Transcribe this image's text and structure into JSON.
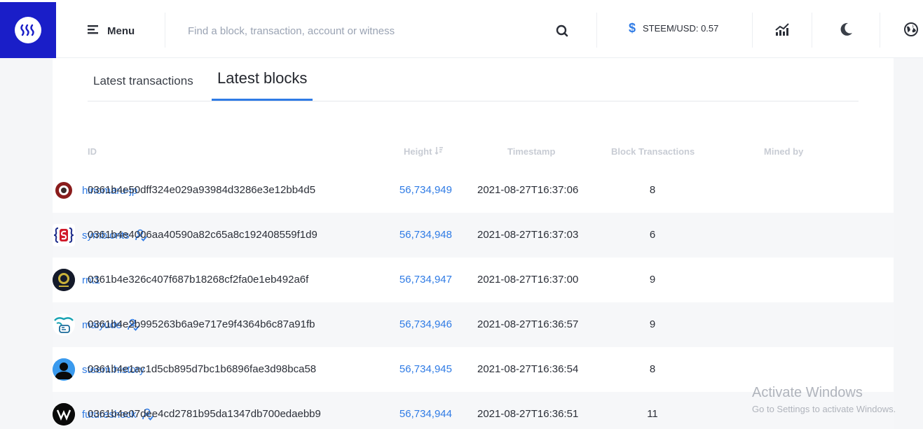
{
  "header": {
    "menu_label": "Menu",
    "search_placeholder": "Find a block, transaction, account or witness",
    "price_label": "STEEM/USD: 0.57",
    "icons": [
      "steem-logo-icon",
      "menu-icon",
      "search-icon",
      "dollar-icon",
      "chart-icon",
      "moon-icon",
      "globe-icon"
    ]
  },
  "tabs": [
    {
      "label": "Latest transactions",
      "active": false
    },
    {
      "label": "Latest blocks",
      "active": true
    }
  ],
  "table": {
    "columns": [
      "ID",
      "Height",
      "Timestamp",
      "Block Transactions",
      "Mined by"
    ],
    "rows": [
      {
        "id": "0361b4e50dff324e029a93984d3286e3e12bb4d5",
        "height": "56,734,949",
        "timestamp": "2021-08-27T16:37:06",
        "tx": "8",
        "miner": "hinomaru-jp",
        "verified": false
      },
      {
        "id": "0361b4e4006aa40590a82c65a8c192408559f1d9",
        "height": "56,734,948",
        "timestamp": "2021-08-27T16:37:03",
        "tx": "6",
        "miner": "symbionts",
        "verified": true
      },
      {
        "id": "0361b4e326c407f687b18268cf2fa0e1eb492a6f",
        "height": "56,734,947",
        "timestamp": "2021-08-27T16:37:00",
        "tx": "9",
        "miner": "rnt1",
        "verified": false
      },
      {
        "id": "0361b4e2b995263b6a9e717e9f4364b6c87a91fb",
        "height": "56,734,946",
        "timestamp": "2021-08-27T16:36:57",
        "tx": "9",
        "miner": "maiyude",
        "verified": true
      },
      {
        "id": "0361b4e1ac1d5cb895d7bc1b6896fae3d98bca58",
        "height": "56,734,945",
        "timestamp": "2021-08-27T16:36:54",
        "tx": "8",
        "miner": "steem.history",
        "verified": false
      },
      {
        "id": "0361b4e07dee4cd2781b95da1347db700edaebb9",
        "height": "56,734,944",
        "timestamp": "2021-08-27T16:36:51",
        "tx": "11",
        "miner": "futureshock",
        "verified": true
      }
    ]
  },
  "watermark": {
    "title": "Activate Windows",
    "subtitle": "Go to Settings to activate Windows."
  },
  "colors": {
    "brand": "#1a1ec8",
    "accent": "#2f7be5",
    "header_text": "#c8ccd4"
  }
}
